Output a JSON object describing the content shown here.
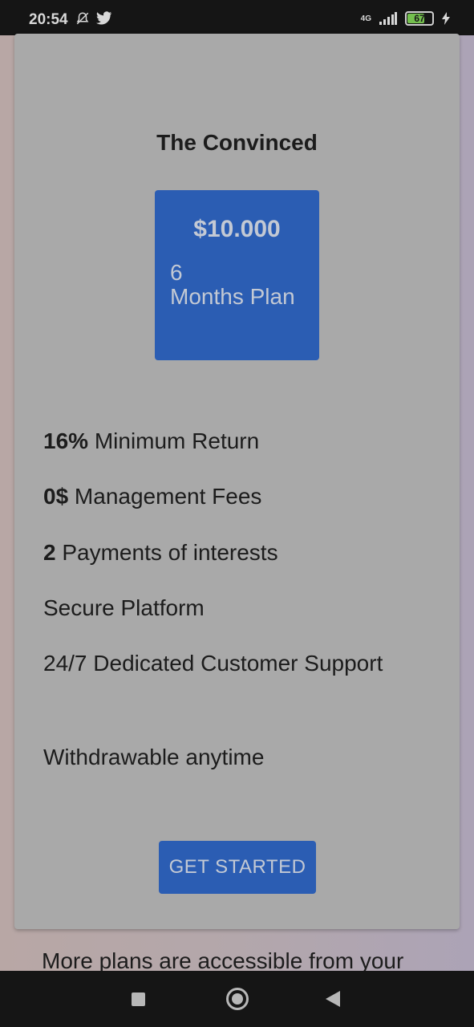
{
  "status_bar": {
    "time": "20:54",
    "network": "4G",
    "battery": "67"
  },
  "card": {
    "title": "The Convinced",
    "price": "$10.000",
    "plan_number": "6",
    "plan_label": "Months Plan",
    "features": [
      {
        "bold": "16%",
        "text": " Minimum Return"
      },
      {
        "bold": "0$",
        "text": " Management Fees"
      },
      {
        "bold": "2",
        "text": " Payments of interests"
      },
      {
        "bold": "",
        "text": "Secure Platform"
      },
      {
        "bold": "",
        "text": "24/7 Dedicated Customer Support"
      },
      {
        "bold": "",
        "text": "Withdrawable anytime"
      }
    ],
    "cta_label": "GET STARTED"
  },
  "footer": {
    "text": "More plans are accessible from your"
  },
  "colors": {
    "accent": "#2b5db3",
    "card_bg": "#a9a9a9",
    "status_bar_bg": "#151515"
  },
  "icons": {
    "mute": "bell-off-icon",
    "twitter": "twitter-icon",
    "signal": "signal-icon",
    "battery": "battery-icon",
    "charging": "lightning-icon"
  }
}
